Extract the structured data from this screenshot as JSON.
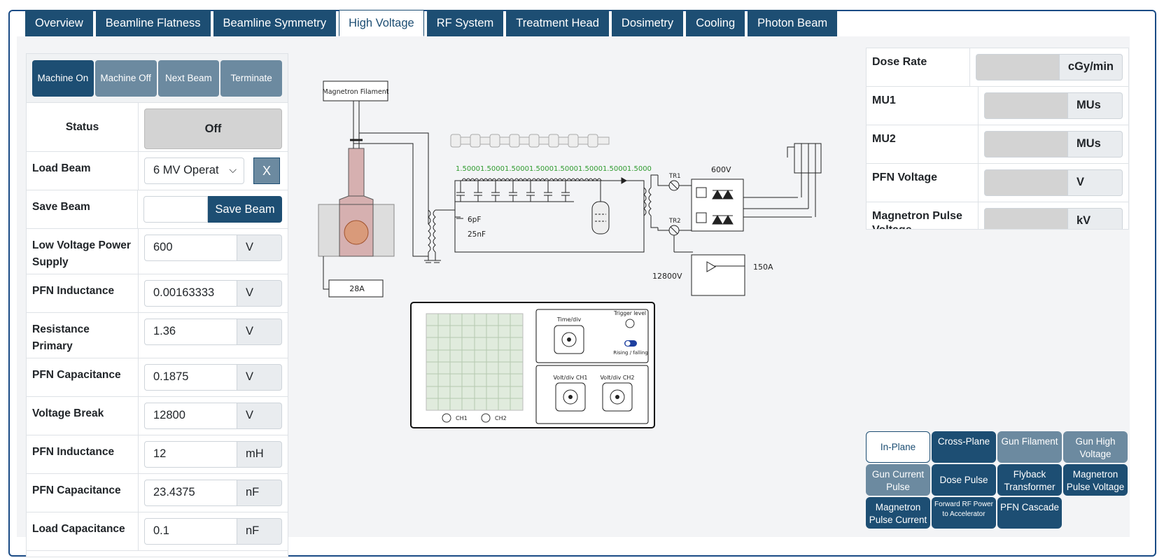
{
  "tabs": [
    {
      "label": "Overview"
    },
    {
      "label": "Beamline Flatness"
    },
    {
      "label": "Beamline Symmetry"
    },
    {
      "label": "High Voltage"
    },
    {
      "label": "RF System"
    },
    {
      "label": "Treatment Head"
    },
    {
      "label": "Dosimetry"
    },
    {
      "label": "Cooling"
    },
    {
      "label": "Photon Beam"
    }
  ],
  "active_tab": "High Voltage",
  "controls": {
    "machine_on": "Machine On",
    "machine_off": "Machine Off",
    "next_beam": "Next Beam",
    "terminate": "Terminate"
  },
  "status": {
    "label": "Status",
    "value": "Off"
  },
  "load_beam": {
    "label": "Load Beam",
    "value": "6 MV Operat",
    "clear": "X"
  },
  "save_beam": {
    "label": "Save Beam",
    "value": "",
    "button": "Save Beam"
  },
  "params": [
    {
      "label": "Low Voltage Power Supply",
      "value": "600",
      "unit": "V"
    },
    {
      "label": "PFN Inductance",
      "value": "0.00163333",
      "unit": "V"
    },
    {
      "label": "Resistance Primary",
      "value": "1.36",
      "unit": "V"
    },
    {
      "label": "PFN Capacitance",
      "value": "0.1875",
      "unit": "V"
    },
    {
      "label": "Voltage Break",
      "value": "12800",
      "unit": "V"
    },
    {
      "label": "PFN Inductance",
      "value": "12",
      "unit": "mH"
    },
    {
      "label": "PFN Capacitance",
      "value": "23.4375",
      "unit": "nF"
    },
    {
      "label": "Load Capacitance",
      "value": "0.1",
      "unit": "nF"
    }
  ],
  "readings": [
    {
      "label": "Dose Rate",
      "unit": "cGy/min"
    },
    {
      "label": "MU1",
      "unit": "MUs"
    },
    {
      "label": "MU2",
      "unit": "MUs"
    },
    {
      "label": "PFN Voltage",
      "unit": "V"
    },
    {
      "label": "Magnetron Pulse Voltage",
      "unit": "kV"
    }
  ],
  "circuit": {
    "magnetron_filament": "Magnetron Filament",
    "filament_current": "28A",
    "pfn_values": "1.50001.50001.50001.50001.50001.50001.50001.5000",
    "cap1": "6pF",
    "cap2": "25nF",
    "tr1": "TR1",
    "tr2": "TR2",
    "supply_voltage": "600V",
    "break_voltage": "12800V",
    "current": "150A",
    "pfn_value_color": "#2e9a2e"
  },
  "oscilloscope": {
    "time_div": "Time/div",
    "trigger": "Trigger level",
    "rising": "Rising / falling",
    "volt_ch1": "Volt/div CH1",
    "volt_ch2": "Volt/div CH2",
    "ch1": "CH1",
    "ch2": "CH2"
  },
  "wave_buttons": [
    {
      "label": "In-Plane"
    },
    {
      "label": "Cross-Plane"
    },
    {
      "label": "Gun Filament"
    },
    {
      "label": "Gun High Voltage"
    },
    {
      "label": "Gun Current Pulse"
    },
    {
      "label": "Dose Pulse"
    },
    {
      "label": "Flyback Transformer"
    },
    {
      "label": "Magnetron Pulse Voltage"
    },
    {
      "label": "Magnetron Pulse Current"
    },
    {
      "label": "Forward RF Power to Accelerator"
    },
    {
      "label": "PFN Cascade"
    }
  ],
  "colors": {
    "primary": "#1d4e73",
    "secondary": "#6c8aa0",
    "frame": "#1a4b85"
  }
}
